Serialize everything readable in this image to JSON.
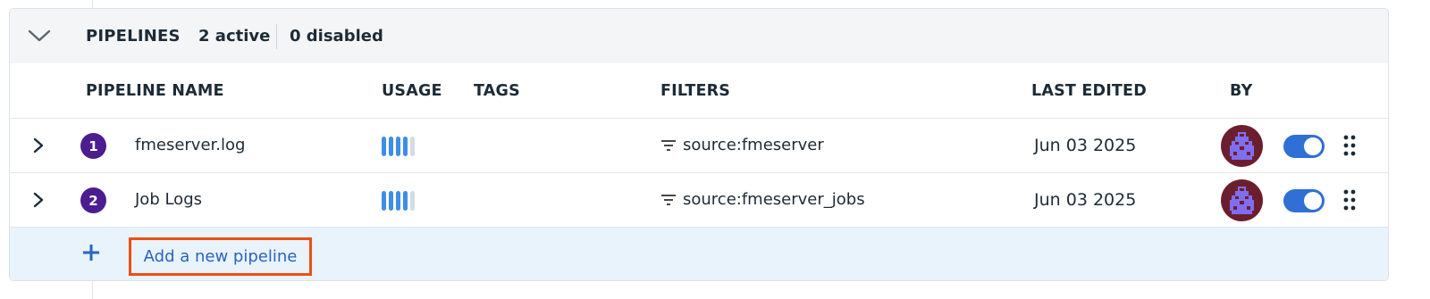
{
  "header": {
    "title": "PIPELINES",
    "active_count": "2 active",
    "disabled_count": "0 disabled"
  },
  "columns": {
    "name": "PIPELINE NAME",
    "usage": "USAGE",
    "tags": "TAGS",
    "filters": "FILTERS",
    "last_edited": "LAST EDITED",
    "by": "BY"
  },
  "pipelines": [
    {
      "index": "1",
      "name": "fmeserver.log",
      "usage_level": 0.8,
      "filter": "source:fmeserver",
      "last_edited": "Jun 03 2025",
      "enabled": true,
      "avatar_icon": "pixel-avatar-icon"
    },
    {
      "index": "2",
      "name": "Job Logs",
      "usage_level": 0.8,
      "filter": "source:fmeserver_jobs",
      "last_edited": "Jun 03 2025",
      "enabled": true,
      "avatar_icon": "pixel-avatar-icon"
    }
  ],
  "add_row": {
    "label": "Add a new pipeline"
  },
  "colors": {
    "accent": "#2f6fd6",
    "index_badge": "#4b1d8f",
    "usage_fill": "#3d8ee6",
    "highlight_box": "#ee4f11",
    "avatar_bg": "#6b1f2e",
    "avatar_fg": "#7f6ef0"
  }
}
